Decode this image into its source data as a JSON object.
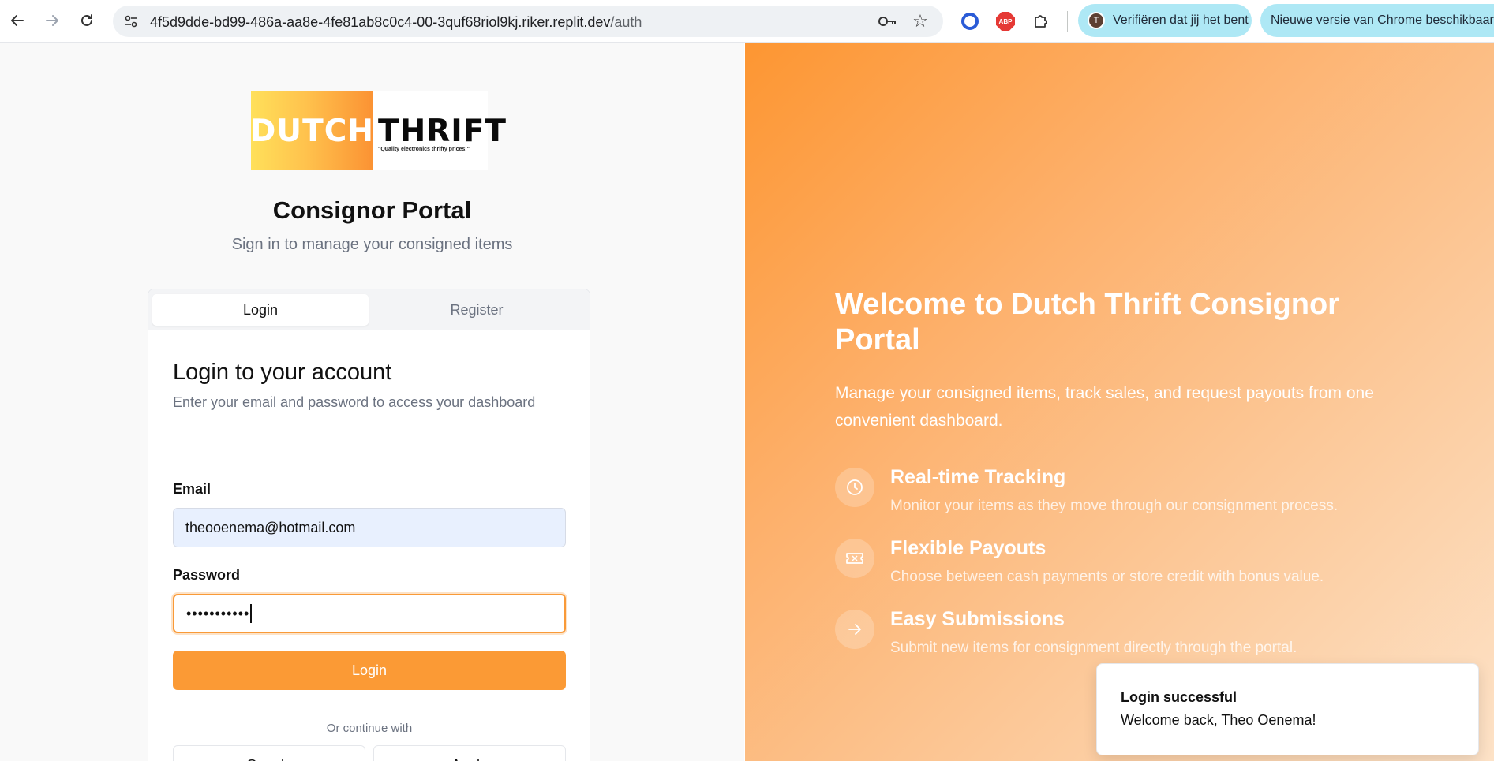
{
  "browser": {
    "url_host": "4f5d9dde-bd99-486a-aa8e-4fe81ab8c0c4-00-3quf68riol9kj.riker.replit.dev",
    "url_path": "/auth",
    "profile_initial": "T",
    "profile_pill": "Verifiëren dat jij het bent",
    "update_pill": "Nieuwe versie van Chrome beschikbaar",
    "abp_label": "ABP"
  },
  "logo": {
    "dutch": "DUTCH",
    "thrift": "THRIFT",
    "tagline": "\"Quality electronics thrifty prices!\""
  },
  "header": {
    "title": "Consignor Portal",
    "subtitle": "Sign in to manage your consigned items"
  },
  "tabs": {
    "login": "Login",
    "register": "Register"
  },
  "form": {
    "title": "Login to your account",
    "subtitle": "Enter your email and password to access your dashboard",
    "email_label": "Email",
    "email_value": "theooenema@hotmail.com",
    "password_label": "Password",
    "password_value": "•••••••••••",
    "login_button": "Login",
    "divider_text": "Or continue with",
    "google_button": "Google",
    "apple_button": "Apple"
  },
  "hero": {
    "title": "Welcome to Dutch Thrift Consignor Portal",
    "subtitle": "Manage your consigned items, track sales, and request payouts from one convenient dashboard.",
    "features": [
      {
        "title": "Real-time Tracking",
        "desc": "Monitor your items as they move through our consignment process.",
        "icon": "clock-icon"
      },
      {
        "title": "Flexible Payouts",
        "desc": "Choose between cash payments or store credit with bonus value.",
        "icon": "ticket-icon"
      },
      {
        "title": "Easy Submissions",
        "desc": "Submit new items for consignment directly through the portal.",
        "icon": "arrow-right-icon"
      }
    ]
  },
  "toast": {
    "title": "Login successful",
    "description": "Welcome back, Theo Oenema!"
  },
  "colors": {
    "accent": "#fb9a35",
    "pill": "#aee8f5"
  }
}
